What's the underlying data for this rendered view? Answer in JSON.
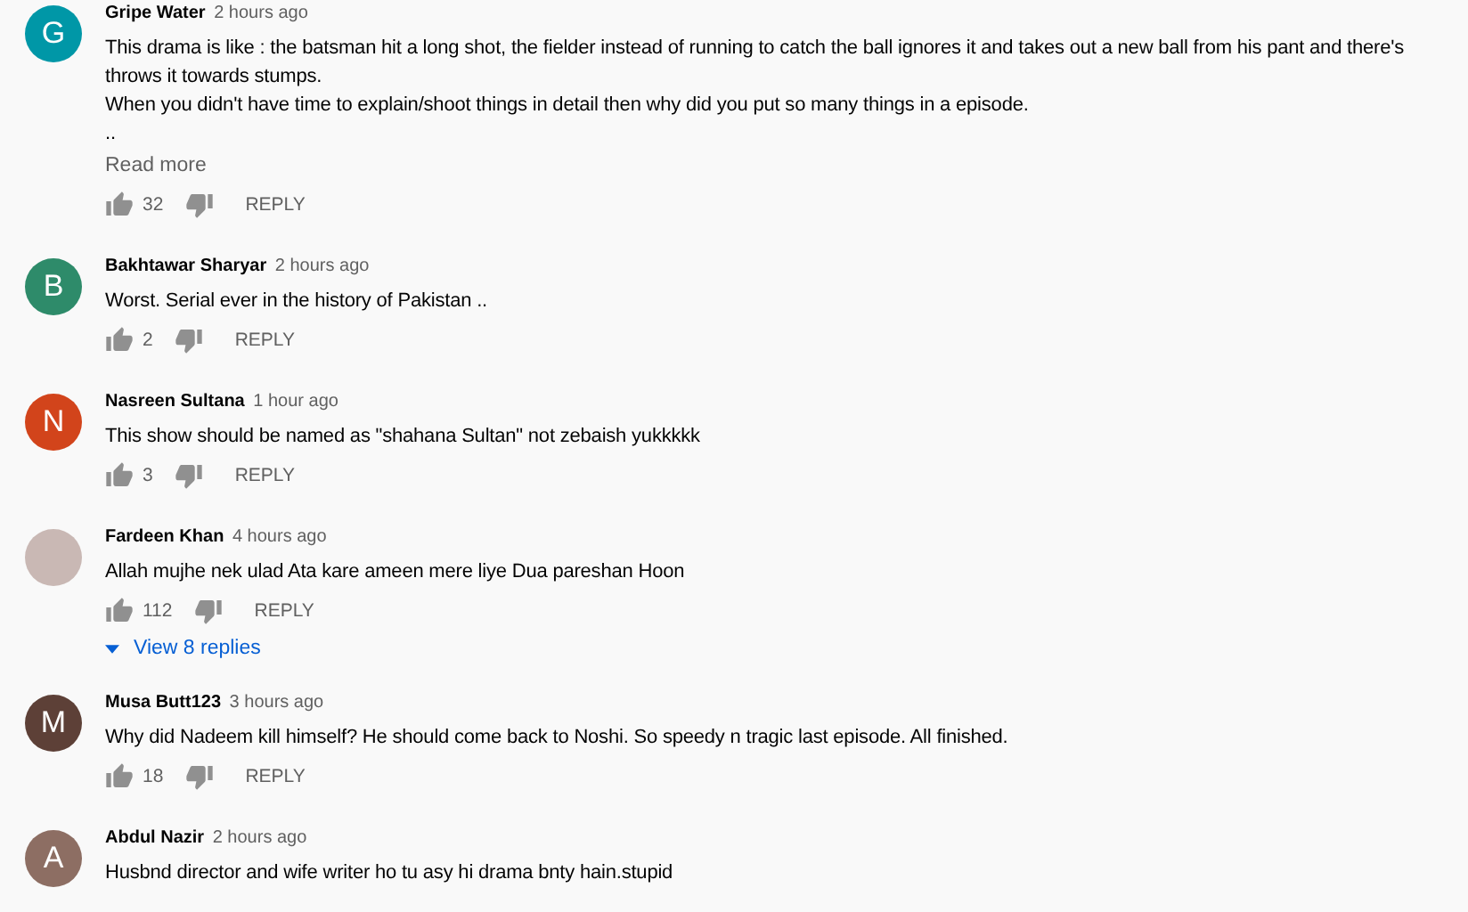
{
  "comments": [
    {
      "avatar": {
        "kind": "letter",
        "letter": "G",
        "color": "#0097a7"
      },
      "author": "Gripe Water",
      "time": "2 hours ago",
      "lines": [
        "This drama is like : the batsman hit a long shot, the fielder instead of running to catch the ball ignores it and takes out a new ball from his pant and there's",
        "throws it towards stumps.",
        "When you didn't have time to explain/shoot things in detail then why did you put so many things in a episode.",
        ".."
      ],
      "read_more": "Read more",
      "likes": "32",
      "reply": "REPLY"
    },
    {
      "avatar": {
        "kind": "letter",
        "letter": "B",
        "color": "#2e8b6a"
      },
      "author": "Bakhtawar Sharyar",
      "time": "2 hours ago",
      "lines": [
        "Worst. Serial ever in the history of Pakistan .."
      ],
      "likes": "2",
      "reply": "REPLY"
    },
    {
      "avatar": {
        "kind": "letter",
        "letter": "N",
        "color": "#d2441b"
      },
      "author": "Nasreen Sultana",
      "time": "1 hour ago",
      "lines": [
        "This show should be named as \"shahana Sultan\" not zebaish yukkkkk"
      ],
      "likes": "3",
      "reply": "REPLY"
    },
    {
      "avatar": {
        "kind": "photo"
      },
      "author": "Fardeen Khan",
      "time": "4 hours ago",
      "lines": [
        "Allah mujhe nek ulad Ata kare ameen mere liye Dua pareshan Hoon"
      ],
      "likes": "112",
      "reply": "REPLY",
      "view_replies": "View 8 replies"
    },
    {
      "avatar": {
        "kind": "letter",
        "letter": "M",
        "color": "#5d4037"
      },
      "author": "Musa Butt123",
      "time": "3 hours ago",
      "lines": [
        "Why did Nadeem kill himself? He should come back to Noshi. So speedy n tragic last episode. All finished."
      ],
      "likes": "18",
      "reply": "REPLY"
    },
    {
      "avatar": {
        "kind": "letter",
        "letter": "A",
        "color": "#8d6e63"
      },
      "author": "Abdul Nazir",
      "time": "2 hours ago",
      "lines": [
        "Husbnd director and wife writer ho tu asy hi drama bnty hain.stupid"
      ]
    }
  ]
}
